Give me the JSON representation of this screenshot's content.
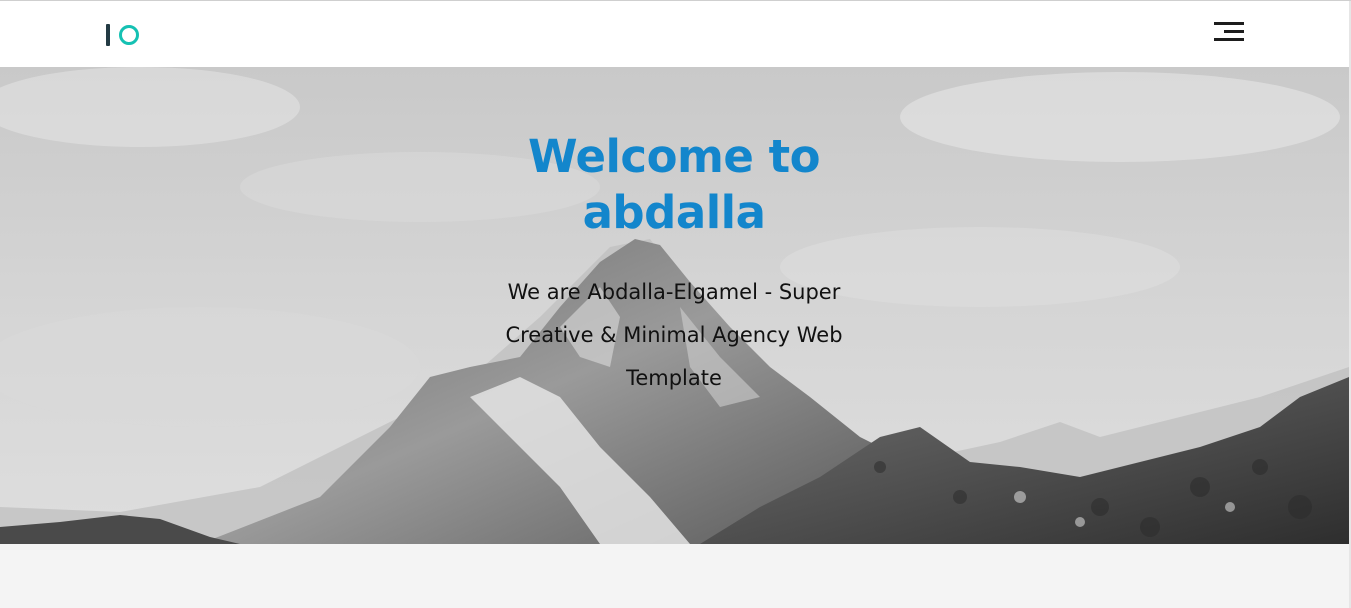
{
  "navbar": {
    "logo_icon": "io-logo-icon",
    "menu_icon": "hamburger-menu-icon"
  },
  "hero": {
    "title": "Welcome to abdalla",
    "subtitle": "We are Abdalla-Elgamel - Super Creative & Minimal Agency Web Template",
    "background": "mountain-grayscale-image"
  },
  "colors": {
    "title": "#1386cc",
    "logo_ring": "#15c1b3",
    "logo_bar": "#233a44",
    "page_bg": "#f4f4f4"
  }
}
